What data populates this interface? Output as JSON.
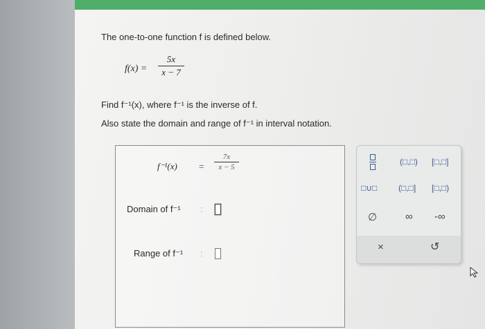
{
  "problem": {
    "intro": "The one-to-one function f is defined below.",
    "fx_label": "f(x) =",
    "numerator": "5x",
    "denominator": "x − 7",
    "find_text": "Find f⁻¹(x), where f⁻¹ is the inverse of f.",
    "state_text": "Also state the domain and range of f⁻¹ in interval notation."
  },
  "answer": {
    "inverse_label": "f⁻¹(x)",
    "equals": "=",
    "inv_numerator": "7x",
    "inv_denominator": "x − 5",
    "domain_label": "Domain of f⁻¹",
    "range_label": "Range of f⁻¹",
    "colon": ":"
  },
  "palette": {
    "row1": [
      "(□,□)",
      "[□,□]"
    ],
    "row2": [
      "□∪□",
      "(□,□]",
      "[□,□)"
    ],
    "row3": [
      "∅",
      "∞",
      "-∞"
    ],
    "clear": "×",
    "undo": "↺"
  },
  "colors": {
    "accent": "#4fae6a",
    "palette_text": "#3a5a90"
  }
}
